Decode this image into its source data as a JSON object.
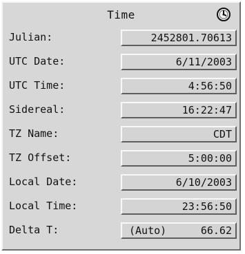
{
  "window": {
    "title": "Time"
  },
  "icons": {
    "title_icon": "clock-icon"
  },
  "rows": [
    {
      "label": "Julian:",
      "value": "2452801.70613"
    },
    {
      "label": "UTC Date:",
      "value": "6/11/2003"
    },
    {
      "label": "UTC Time:",
      "value": "4:56:50"
    },
    {
      "label": "Sidereal:",
      "value": "16:22:47"
    },
    {
      "label": "TZ Name:",
      "value": "CDT"
    },
    {
      "label": "TZ Offset:",
      "value": "5:00:00"
    },
    {
      "label": "Local Date:",
      "value": "6/10/2003"
    },
    {
      "label": "Local Time:",
      "value": "23:56:50"
    },
    {
      "label": "Delta T:",
      "mode": "(Auto)",
      "value": "66.62"
    }
  ],
  "colors": {
    "panel_bg": "#d7d7d7",
    "text": "#111111"
  }
}
